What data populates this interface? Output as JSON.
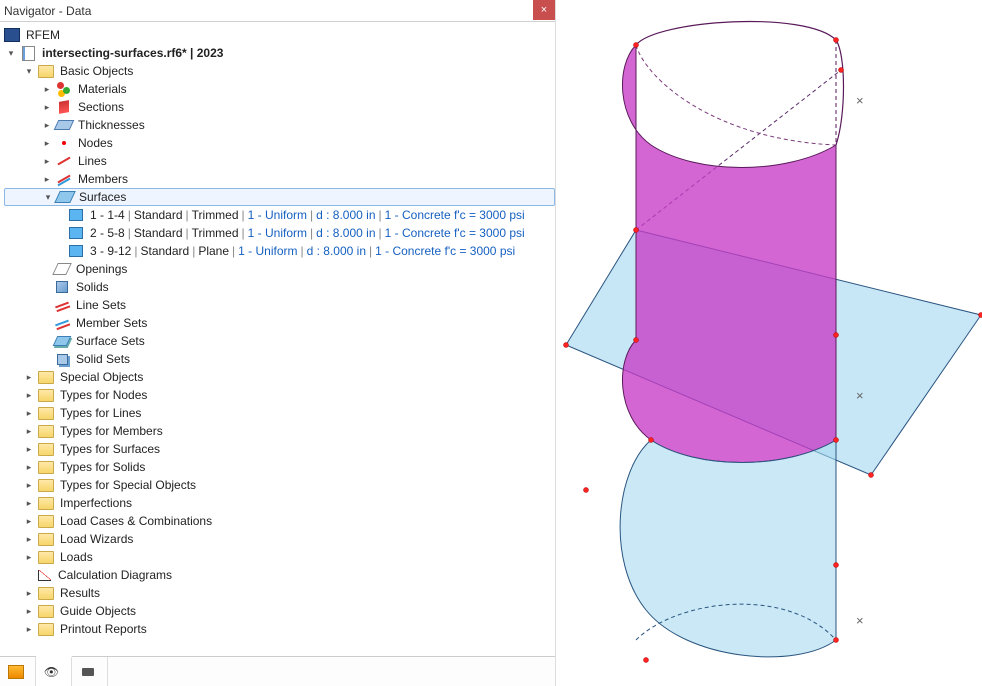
{
  "window": {
    "title": "Navigator - Data",
    "close": "×"
  },
  "tree": {
    "root": "RFEM",
    "file_label": "intersecting-surfaces.rf6* | 2023",
    "basic_objects": "Basic Objects",
    "materials": "Materials",
    "sections": "Sections",
    "thicknesses": "Thicknesses",
    "nodes": "Nodes",
    "lines": "Lines",
    "members": "Members",
    "surfaces": "Surfaces",
    "surf_items": [
      {
        "id": "1",
        "range": "1-4",
        "std": "Standard",
        "shape": "Trimmed",
        "uniform": "1 - Uniform",
        "d": "d : 8.000 in",
        "mat": "1 - Concrete f'c = 3000 psi"
      },
      {
        "id": "2",
        "range": "5-8",
        "std": "Standard",
        "shape": "Trimmed",
        "uniform": "1 - Uniform",
        "d": "d : 8.000 in",
        "mat": "1 - Concrete f'c = 3000 psi"
      },
      {
        "id": "3",
        "range": "9-12",
        "std": "Standard",
        "shape": "Plane",
        "uniform": "1 - Uniform",
        "d": "d : 8.000 in",
        "mat": "1 - Concrete f'c = 3000 psi"
      }
    ],
    "openings": "Openings",
    "solids": "Solids",
    "line_sets": "Line Sets",
    "member_sets": "Member Sets",
    "surface_sets": "Surface Sets",
    "solid_sets": "Solid Sets",
    "folders": [
      "Special Objects",
      "Types for Nodes",
      "Types for Lines",
      "Types for Members",
      "Types for Surfaces",
      "Types for Solids",
      "Types for Special Objects",
      "Imperfections",
      "Load Cases & Combinations",
      "Load Wizards",
      "Loads"
    ],
    "calc_diagrams": "Calculation Diagrams",
    "results_folders": [
      "Results",
      "Guide Objects",
      "Printout Reports"
    ]
  },
  "viewport_markers": [
    "×",
    "×",
    "×"
  ]
}
